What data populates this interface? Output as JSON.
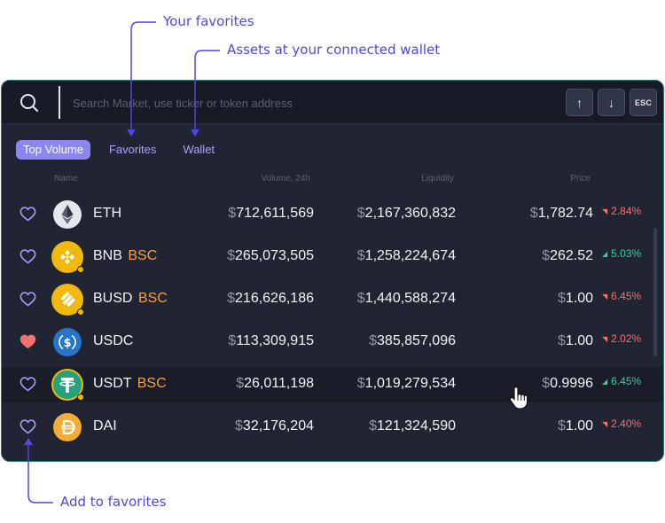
{
  "annotations": {
    "favorites": "Your favorites",
    "wallet": "Assets at your connected wallet",
    "add_favorites": "Add to favorites"
  },
  "search": {
    "placeholder": "Search Market, use ticker or token address",
    "keys": {
      "up": "↑",
      "down": "↓",
      "esc": "ESC"
    }
  },
  "tabs": [
    {
      "label": "Top Volume",
      "active": true
    },
    {
      "label": "Favorites",
      "active": false
    },
    {
      "label": "Wallet",
      "active": false
    }
  ],
  "columns": {
    "name": "Name",
    "volume": "Volume, 24h",
    "liquidity": "Liquidity",
    "price": "Price"
  },
  "currency_symbol": "$",
  "rows": [
    {
      "symbol": "ETH",
      "chain": "",
      "icon": "eth-icon",
      "favorite": false,
      "volume": "712,611,569",
      "liquidity": "2,167,360,832",
      "price": "1,782.74",
      "change": "2.84%",
      "direction": "down"
    },
    {
      "symbol": "BNB",
      "chain": "BSC",
      "icon": "bnb-icon",
      "favorite": false,
      "volume": "265,073,505",
      "liquidity": "1,258,224,674",
      "price": "262.52",
      "change": "5.03%",
      "direction": "up"
    },
    {
      "symbol": "BUSD",
      "chain": "BSC",
      "icon": "busd-icon",
      "favorite": false,
      "volume": "216,626,186",
      "liquidity": "1,440,588,274",
      "price": "1.00",
      "change": "6.45%",
      "direction": "down"
    },
    {
      "symbol": "USDC",
      "chain": "",
      "icon": "usdc-icon",
      "favorite": true,
      "volume": "113,309,915",
      "liquidity": "385,857,096",
      "price": "1.00",
      "change": "2.02%",
      "direction": "down"
    },
    {
      "symbol": "USDT",
      "chain": "BSC",
      "icon": "usdt-icon",
      "favorite": false,
      "volume": "26,011,198",
      "liquidity": "1,019,279,534",
      "price": "0.9996",
      "change": "6.45%",
      "direction": "up"
    },
    {
      "symbol": "DAI",
      "chain": "",
      "icon": "dai-icon",
      "favorite": false,
      "volume": "32,176,204",
      "liquidity": "121,324,590",
      "price": "1.00",
      "change": "2.40%",
      "direction": "down"
    }
  ],
  "colors": {
    "accent": "#4f46e5",
    "tab_active": "#8b86f0",
    "positive": "#34d399",
    "negative": "#f87171",
    "bsc": "#f59e42",
    "favorite_heart": "#f87171"
  }
}
